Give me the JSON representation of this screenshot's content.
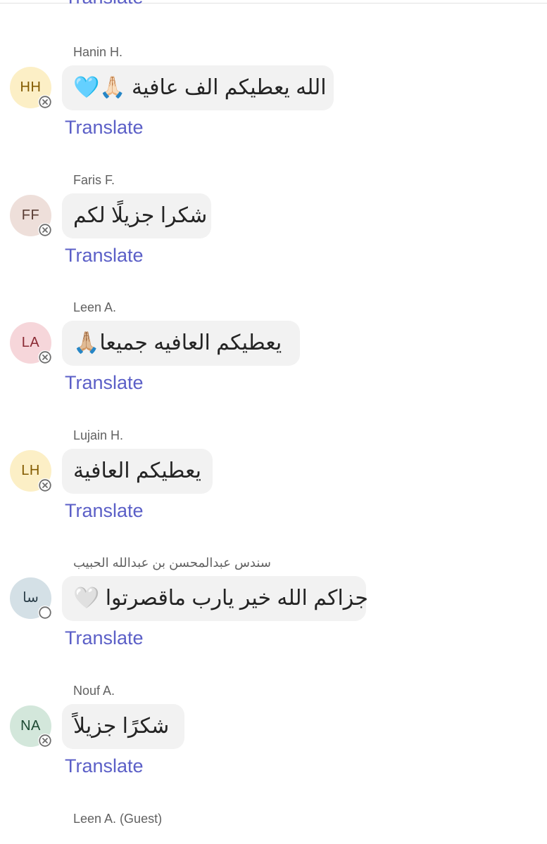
{
  "chat": {
    "translate_label": "Translate",
    "messages": [
      {
        "sender": "Hanin H.",
        "initials": "HH",
        "avatar_bg": "#fcefc6",
        "avatar_fg": "#835b00",
        "status": "unavailable",
        "text": "الله يعطيكم الف عافية 🙏🏻🩵"
      },
      {
        "sender": "Faris F.",
        "initials": "FF",
        "avatar_bg": "#eedfda",
        "avatar_fg": "#5a3c33",
        "status": "unavailable",
        "text": "شكرا جزيلًا لكم"
      },
      {
        "sender": "Leen A.",
        "initials": "LA",
        "avatar_bg": "#f6d6da",
        "avatar_fg": "#8a2a34",
        "status": "unavailable",
        "text": "يعطيكم العافيه جميعا🙏🏼"
      },
      {
        "sender": "Lujain H.",
        "initials": "LH",
        "avatar_bg": "#fcefc6",
        "avatar_fg": "#835b00",
        "status": "unavailable",
        "text": "يعطيكم العافية"
      },
      {
        "sender": "سندس عبدالمحسن بن عبدالله الحبيب",
        "initials": "سا",
        "avatar_bg": "#d4e0e6",
        "avatar_fg": "#2b3e49",
        "status": "offline",
        "text": "جزاكم الله خير يارب ماقصرتوا 🤍"
      },
      {
        "sender": "Nouf A.",
        "initials": "NA",
        "avatar_bg": "#d3e7db",
        "avatar_fg": "#1e4a33",
        "status": "unavailable",
        "text": "شكرًا جزيلاً"
      }
    ],
    "next_sender": "Leen A. (Guest)"
  }
}
